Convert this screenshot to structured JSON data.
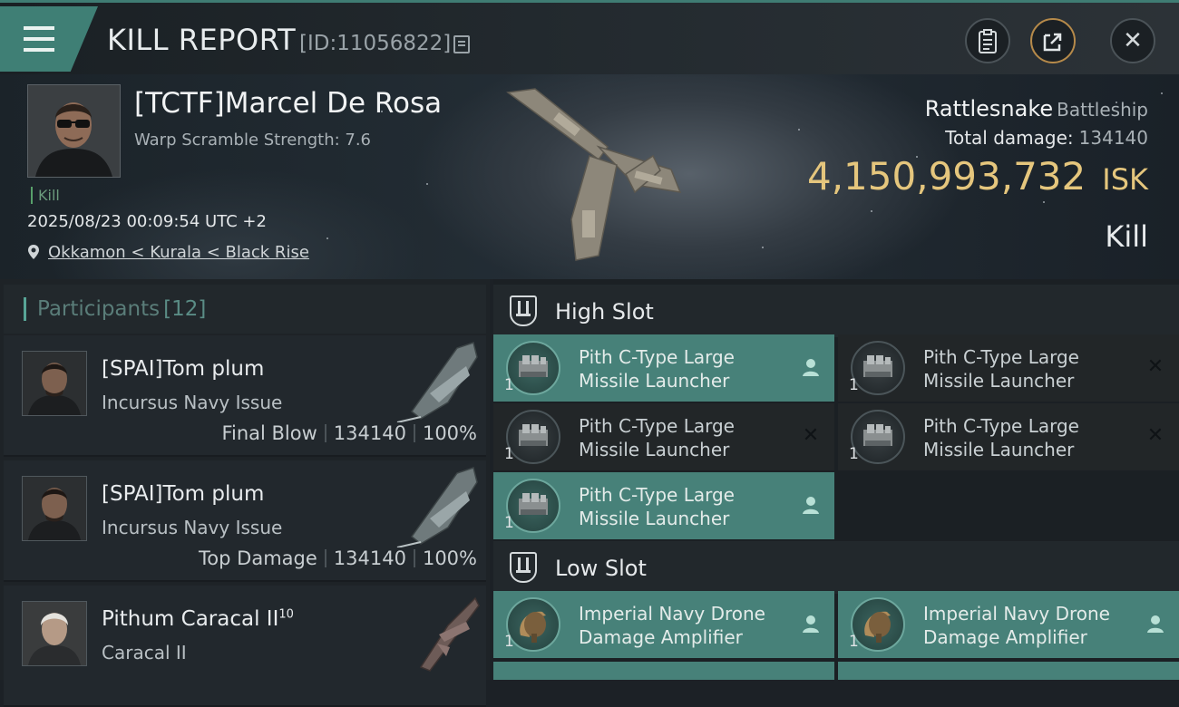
{
  "header": {
    "title": "KILL REPORT",
    "report_id": "[ID:11056822]",
    "menu_icon": "hamburger-icon",
    "buttons": [
      {
        "name": "clipboard",
        "icon": "clipboard-icon"
      },
      {
        "name": "share",
        "icon": "share-icon"
      },
      {
        "name": "close",
        "icon": "close-icon",
        "glyph": "✕"
      }
    ]
  },
  "victim": {
    "name": "[TCTF]Marcel De Rosa",
    "warp_scramble": "Warp Scramble Strength: 7.6",
    "kill_label": "Kill",
    "datetime": "2025/08/23 00:09:54 UTC +2",
    "location": "Okkamon < Kurala < Black Rise",
    "ship_name": "Rattlesnake",
    "ship_class": "Battleship",
    "total_damage_label": "Total damage:",
    "total_damage_value": "134140",
    "isk_value": "4,150,993,732",
    "isk_unit": "ISK",
    "result": "Kill"
  },
  "participants": {
    "title": "Participants",
    "count": "[12]",
    "items": [
      {
        "name": "[SPAI]Tom plum",
        "ship": "Incursus Navy Issue",
        "role": "Final Blow",
        "damage": "134140",
        "percent": "100%"
      },
      {
        "name": "[SPAI]Tom plum",
        "ship": "Incursus Navy Issue",
        "role": "Top Damage",
        "damage": "134140",
        "percent": "100%"
      },
      {
        "name": "Pithum Caracal II",
        "name_sup": "10",
        "ship": "Caracal II"
      }
    ]
  },
  "high_slot": {
    "label": "High Slot",
    "modules": [
      {
        "name": "Pith C-Type Large Missile Launcher",
        "qty": "1",
        "status": "dropped",
        "status_icon": "person-icon"
      },
      {
        "name": "Pith C-Type Large Missile Launcher",
        "qty": "1",
        "status": "destroyed",
        "status_icon": "x-icon",
        "glyph": "✕"
      },
      {
        "name": "Pith C-Type Large Missile Launcher",
        "qty": "1",
        "status": "destroyed",
        "status_icon": "x-icon",
        "glyph": "✕"
      },
      {
        "name": "Pith C-Type Large Missile Launcher",
        "qty": "1",
        "status": "destroyed",
        "status_icon": "x-icon",
        "glyph": "✕"
      },
      {
        "name": "Pith C-Type Large Missile Launcher",
        "qty": "1",
        "status": "dropped",
        "status_icon": "person-icon"
      }
    ]
  },
  "low_slot": {
    "label": "Low Slot",
    "modules": [
      {
        "name": "Imperial Navy Drone Damage Amplifier",
        "qty": "1",
        "status": "dropped",
        "status_icon": "person-icon"
      },
      {
        "name": "Imperial Navy Drone Damage Amplifier",
        "qty": "1",
        "status": "dropped",
        "status_icon": "person-icon"
      }
    ]
  },
  "colors": {
    "accent_teal": "#478179",
    "isk_gold": "#e5c67d",
    "share_ring": "#b68a4a"
  }
}
